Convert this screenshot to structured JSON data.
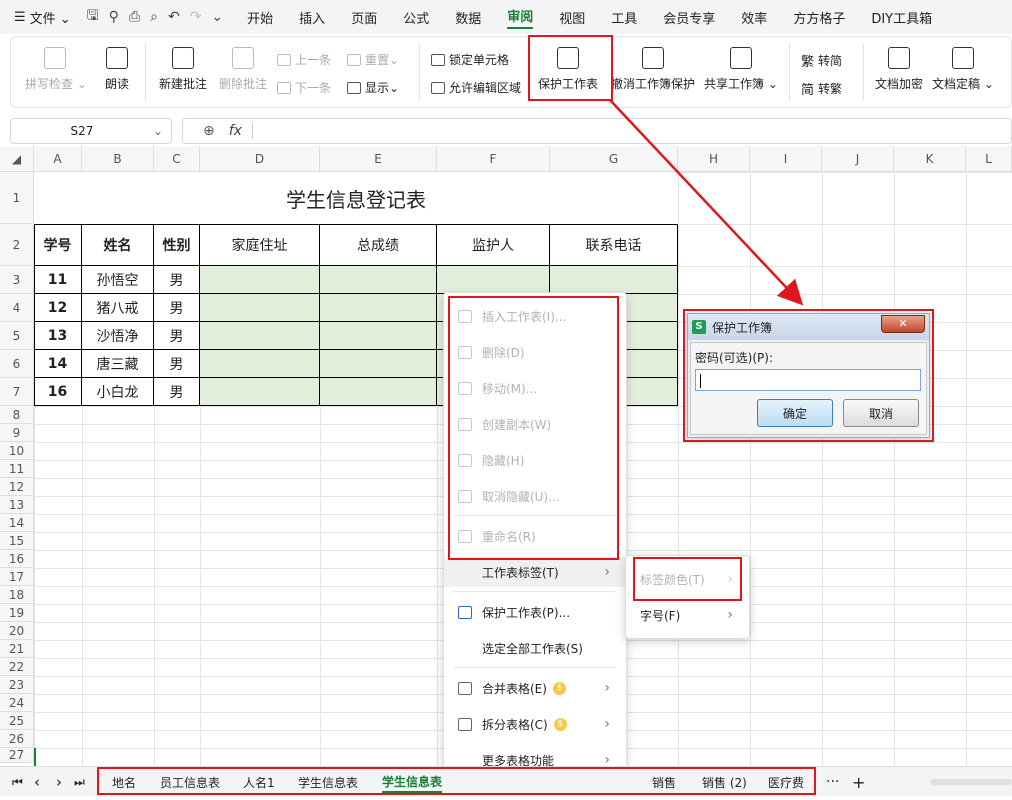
{
  "menubar": {
    "hamburger": "☰",
    "file": "文件",
    "items": [
      "开始",
      "插入",
      "页面",
      "公式",
      "数据",
      "审阅",
      "视图",
      "工具",
      "会员专享",
      "效率",
      "方方格子",
      "DIY工具箱"
    ],
    "active": "审阅"
  },
  "ribbon": {
    "spell_check": "拼写检查",
    "read_aloud": "朗读",
    "new_comment": "新建批注",
    "delete_comment": "删除批注",
    "prev": "上一条",
    "next": "下一条",
    "reset": "重置",
    "show": "显示",
    "lock_cells": "锁定单元格",
    "allow_edit_ranges": "允许编辑区域",
    "protect_sheet": "保护工作表",
    "unprotect_workbook": "撤消工作簿保护",
    "share_workbook": "共享工作簿",
    "to_simplified": "转简",
    "to_traditional": "转繁",
    "trad_char": "繁",
    "simp_char": "简",
    "doc_encrypt": "文档加密",
    "doc_finalize": "文档定稿"
  },
  "formula_bar": {
    "name_box": "S27",
    "fx": "fx",
    "value": ""
  },
  "columns": [
    "A",
    "B",
    "C",
    "D",
    "E",
    "F",
    "G",
    "H",
    "I",
    "J",
    "K",
    "L"
  ],
  "rows": [
    "1",
    "2",
    "3",
    "4",
    "5",
    "6",
    "7",
    "8",
    "9",
    "10",
    "11",
    "12",
    "13",
    "14",
    "15",
    "16",
    "17",
    "18",
    "19",
    "20",
    "21",
    "22",
    "23",
    "24",
    "25",
    "26",
    "27"
  ],
  "sheet": {
    "title": "学生信息登记表",
    "headers": [
      "学号",
      "姓名",
      "性别",
      "家庭住址",
      "总成绩",
      "监护人",
      "联系电话"
    ],
    "records": [
      [
        "11",
        "孙悟空",
        "男"
      ],
      [
        "12",
        "猪八戒",
        "男"
      ],
      [
        "13",
        "沙悟净",
        "男"
      ],
      [
        "14",
        "唐三藏",
        "男"
      ],
      [
        "16",
        "小白龙",
        "男"
      ]
    ]
  },
  "context_menu": {
    "disabled_items": [
      "插入工作表(I)...",
      "删除(D)",
      "移动(M)...",
      "创建副本(W)",
      "隐藏(H)",
      "取消隐藏(U)...",
      "重命名(R)"
    ],
    "sheet_tab": "工作表标签(T)",
    "protect_sheet": "保护工作表(P)...",
    "select_all_sheets": "选定全部工作表(S)",
    "merge_tables": "合并表格(E)",
    "split_table": "拆分表格(C)",
    "more_features": "更多表格功能",
    "arrow": "›",
    "coin": "$"
  },
  "submenu": {
    "tab_color": "标签颜色(T)",
    "font_size": "字号(F)"
  },
  "dialog": {
    "app_icon": "S",
    "title": "保护工作簿",
    "close": "✕",
    "label": "密码(可选)(P):",
    "password": "",
    "ok": "确定",
    "cancel": "取消"
  },
  "tabs": {
    "nav": [
      "⏮",
      "‹",
      "›",
      "⏭"
    ],
    "sheets": [
      "地名",
      "员工信息表",
      "人名1",
      "学生信息表",
      "学生信息表",
      "销售",
      "销售 (2)",
      "医疗费"
    ],
    "active_index": 4,
    "more": "···",
    "add": "+"
  },
  "colors": {
    "accent": "#1a7f37",
    "highlight_red": "#e0161d",
    "cell_fill": "#e2efda"
  }
}
